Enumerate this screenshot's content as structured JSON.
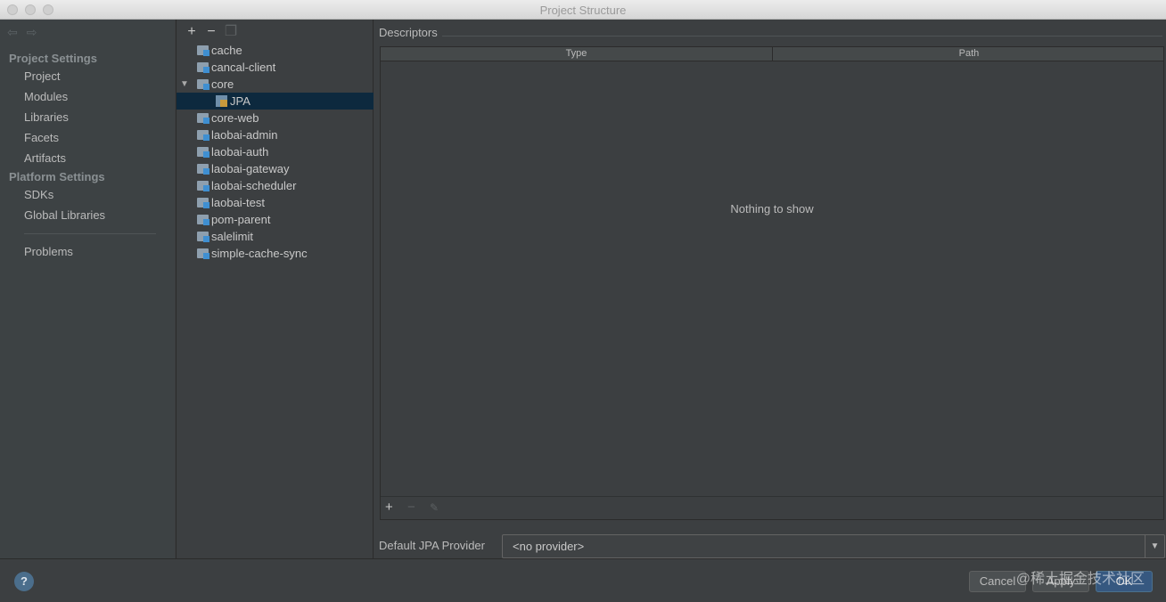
{
  "window": {
    "title": "Project Structure"
  },
  "nav": {
    "back_icon": "back-arrow-icon",
    "forward_icon": "forward-arrow-icon",
    "project_settings_header": "Project Settings",
    "project_items": [
      "Project",
      "Modules",
      "Libraries",
      "Facets",
      "Artifacts"
    ],
    "platform_settings_header": "Platform Settings",
    "platform_items": [
      "SDKs",
      "Global Libraries"
    ],
    "problems": "Problems"
  },
  "tree": {
    "toolbar": {
      "add": "+",
      "remove": "−",
      "copy_icon": "copy-icon"
    },
    "items": [
      {
        "label": "cache",
        "level": 0,
        "icon": "module-folder-icon"
      },
      {
        "label": "cancal-client",
        "level": 0,
        "icon": "module-folder-icon"
      },
      {
        "label": "core",
        "level": 0,
        "icon": "module-folder-icon",
        "expanded": true
      },
      {
        "label": "JPA",
        "level": 1,
        "icon": "jpa-facet-icon",
        "selected": true
      },
      {
        "label": "core-web",
        "level": 0,
        "icon": "module-folder-icon"
      },
      {
        "label": "laobai-admin",
        "level": 0,
        "icon": "module-folder-icon"
      },
      {
        "label": "laobai-auth",
        "level": 0,
        "icon": "module-folder-icon"
      },
      {
        "label": "laobai-gateway",
        "level": 0,
        "icon": "module-folder-icon"
      },
      {
        "label": "laobai-scheduler",
        "level": 0,
        "icon": "module-folder-icon"
      },
      {
        "label": "laobai-test",
        "level": 0,
        "icon": "module-folder-icon"
      },
      {
        "label": "pom-parent",
        "level": 0,
        "icon": "module-folder-icon"
      },
      {
        "label": "salelimit",
        "level": 0,
        "icon": "module-folder-icon"
      },
      {
        "label": "simple-cache-sync",
        "level": 0,
        "icon": "module-folder-icon"
      }
    ]
  },
  "descriptors": {
    "label": "Descriptors",
    "columns": [
      "Type",
      "Path"
    ],
    "empty_text": "Nothing to show",
    "toolbar": {
      "add": "+",
      "remove": "−",
      "edit_icon": "pencil-icon"
    }
  },
  "provider": {
    "label": "Default JPA Provider",
    "value": "<no provider>"
  },
  "footer": {
    "help": "?",
    "cancel": "Cancel",
    "apply": "Apply",
    "ok": "OK",
    "watermark": "@稀土掘金技术社区"
  },
  "colors": {
    "background": "#3c3f41",
    "selection": "#0d293e",
    "primary_button": "#365880"
  }
}
